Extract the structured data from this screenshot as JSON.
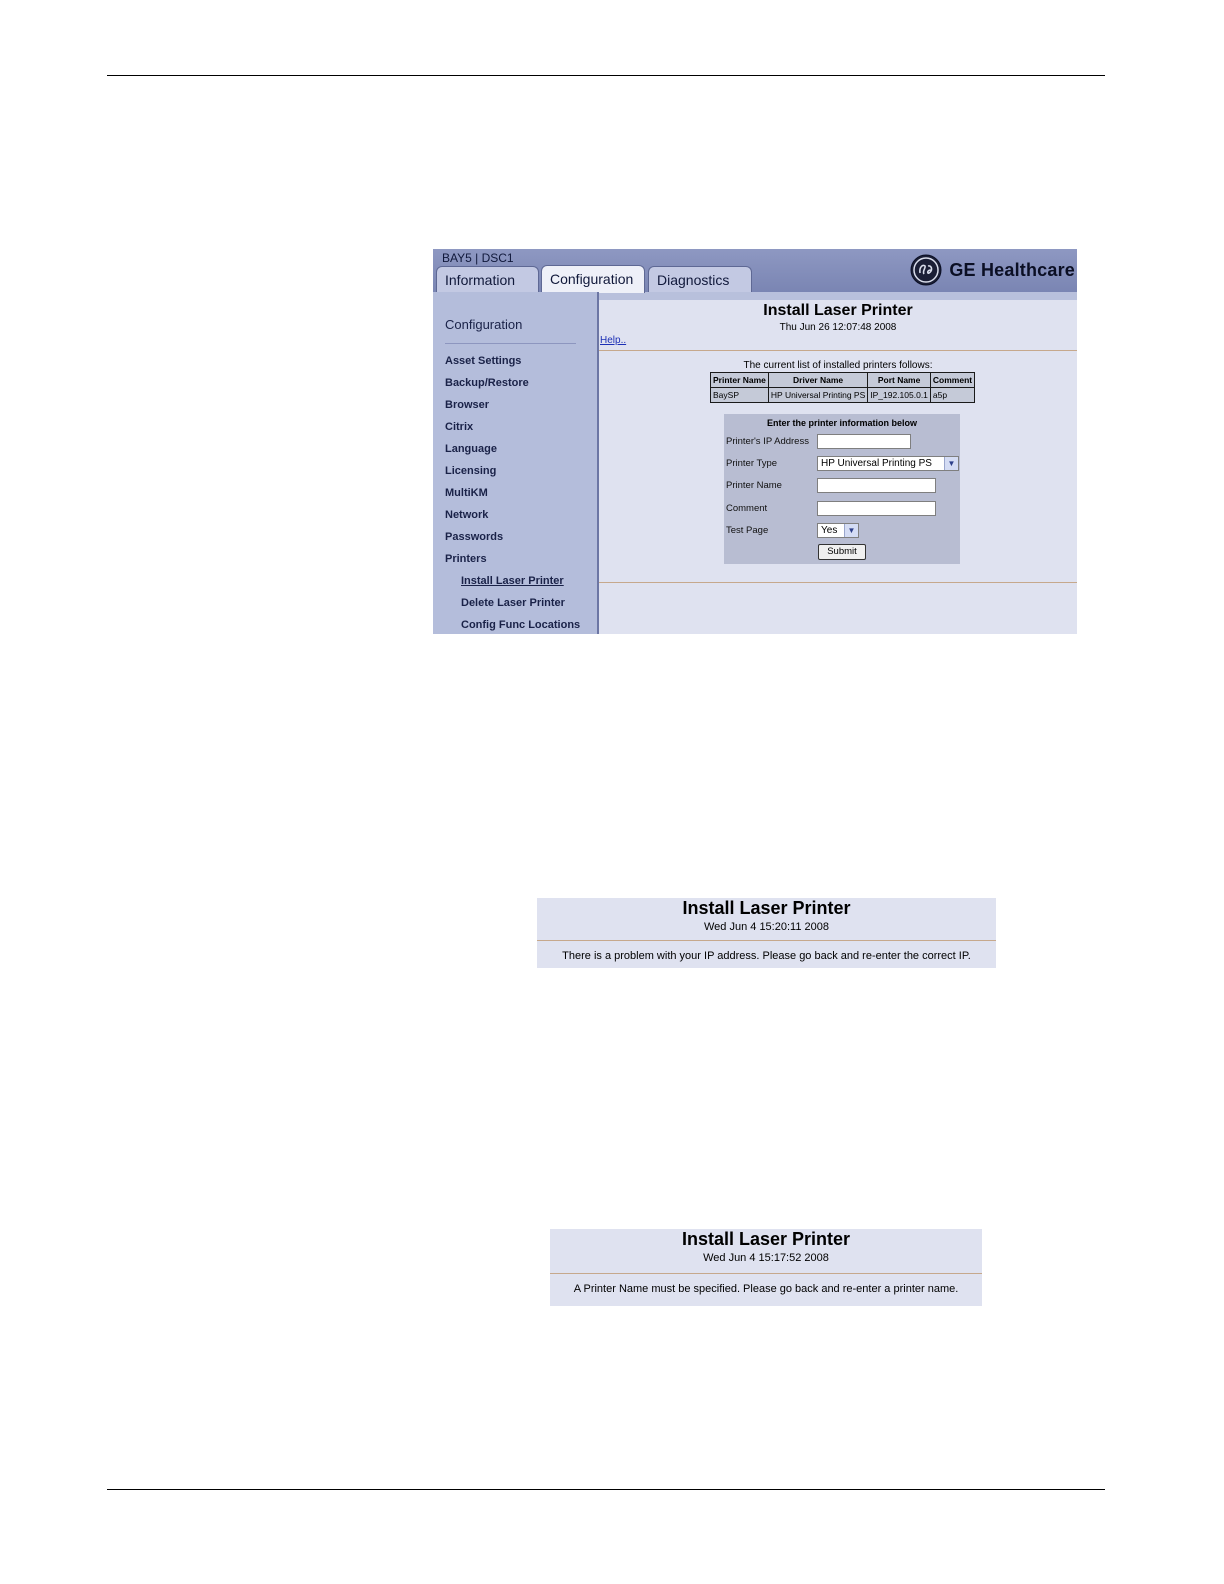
{
  "app": {
    "device_id": "BAY5 | DSC1",
    "tabs": [
      {
        "label": "Information"
      },
      {
        "label": "Configuration"
      },
      {
        "label": "Diagnostics"
      }
    ],
    "brand": "GE Healthcare",
    "sidebar": {
      "title": "Configuration",
      "items": [
        {
          "label": "Asset Settings"
        },
        {
          "label": "Backup/Restore"
        },
        {
          "label": "Browser"
        },
        {
          "label": "Citrix"
        },
        {
          "label": "Language"
        },
        {
          "label": "Licensing"
        },
        {
          "label": "MultiKM"
        },
        {
          "label": "Network"
        },
        {
          "label": "Passwords"
        },
        {
          "label": "Printers"
        }
      ],
      "subitems": [
        {
          "label": "Install Laser Printer"
        },
        {
          "label": "Delete Laser Printer"
        },
        {
          "label": "Config Func Locations"
        }
      ]
    },
    "content": {
      "title": "Install Laser Printer",
      "date": "Thu Jun 26 12:07:48 2008",
      "help": "Help..",
      "list_caption": "The current list of installed printers follows:",
      "table": {
        "headers": [
          "Printer Name",
          "Driver Name",
          "Port Name",
          "Comment"
        ],
        "rows": [
          [
            "BaySP",
            "HP Universal Printing PS",
            "IP_192.105.0.1",
            "a5p"
          ]
        ]
      },
      "form": {
        "heading": "Enter the printer information below",
        "ip_label": "Printer's IP Address",
        "ip_value": "",
        "type_label": "Printer Type",
        "type_value": "HP Universal Printing PS",
        "name_label": "Printer Name",
        "name_value": "",
        "comment_label": "Comment",
        "comment_value": "",
        "testpage_label": "Test Page",
        "testpage_value": "Yes",
        "submit_label": "Submit"
      }
    }
  },
  "error_ip": {
    "title": "Install Laser Printer",
    "date": "Wed Jun 4 15:20:11 2008",
    "message": "There is a problem with your IP address. Please go back and re-enter the correct IP."
  },
  "error_name": {
    "title": "Install Laser Printer",
    "date": "Wed Jun 4 15:17:52 2008",
    "message": "A Printer Name must be specified. Please go back and re-enter a printer name."
  }
}
